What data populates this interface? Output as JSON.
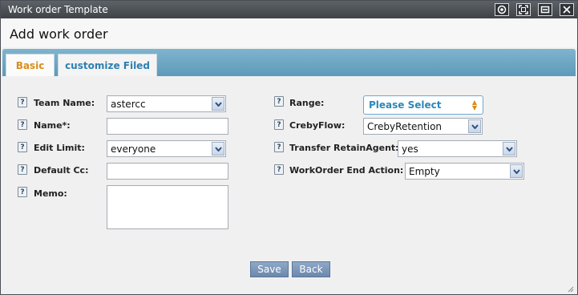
{
  "window": {
    "title": "Work order Template"
  },
  "header": {
    "title": "Add work order"
  },
  "tabs": [
    {
      "label": "Basic"
    },
    {
      "label": "customize Filed"
    }
  ],
  "help_icon_text": "?",
  "left_fields": {
    "team_name": {
      "label": "Team Name:",
      "value": "astercc"
    },
    "name": {
      "label": "Name*:",
      "value": ""
    },
    "edit_limit": {
      "label": "Edit Limit:",
      "value": "everyone"
    },
    "default_cc": {
      "label": "Default Cc:",
      "value": ""
    },
    "memo": {
      "label": "Memo:",
      "value": ""
    }
  },
  "right_fields": {
    "range": {
      "label": "Range:",
      "value": "Please Select"
    },
    "creby_flow": {
      "label": "CrebyFlow:",
      "value": "CrebyRetention"
    },
    "transfer_retain_agent": {
      "label": "Transfer RetainAgent:",
      "value": "yes"
    },
    "workorder_end_action": {
      "label": "WorkOrder End Action:",
      "value": "Empty"
    }
  },
  "buttons": {
    "save": "Save",
    "back": "Back"
  },
  "colors": {
    "titlebar": "#4b5055",
    "tabbar": "#6aa6c4",
    "active_tab_text": "#d98e1a",
    "inactive_tab_text": "#2d7fb0",
    "button": "#7a96ba"
  }
}
